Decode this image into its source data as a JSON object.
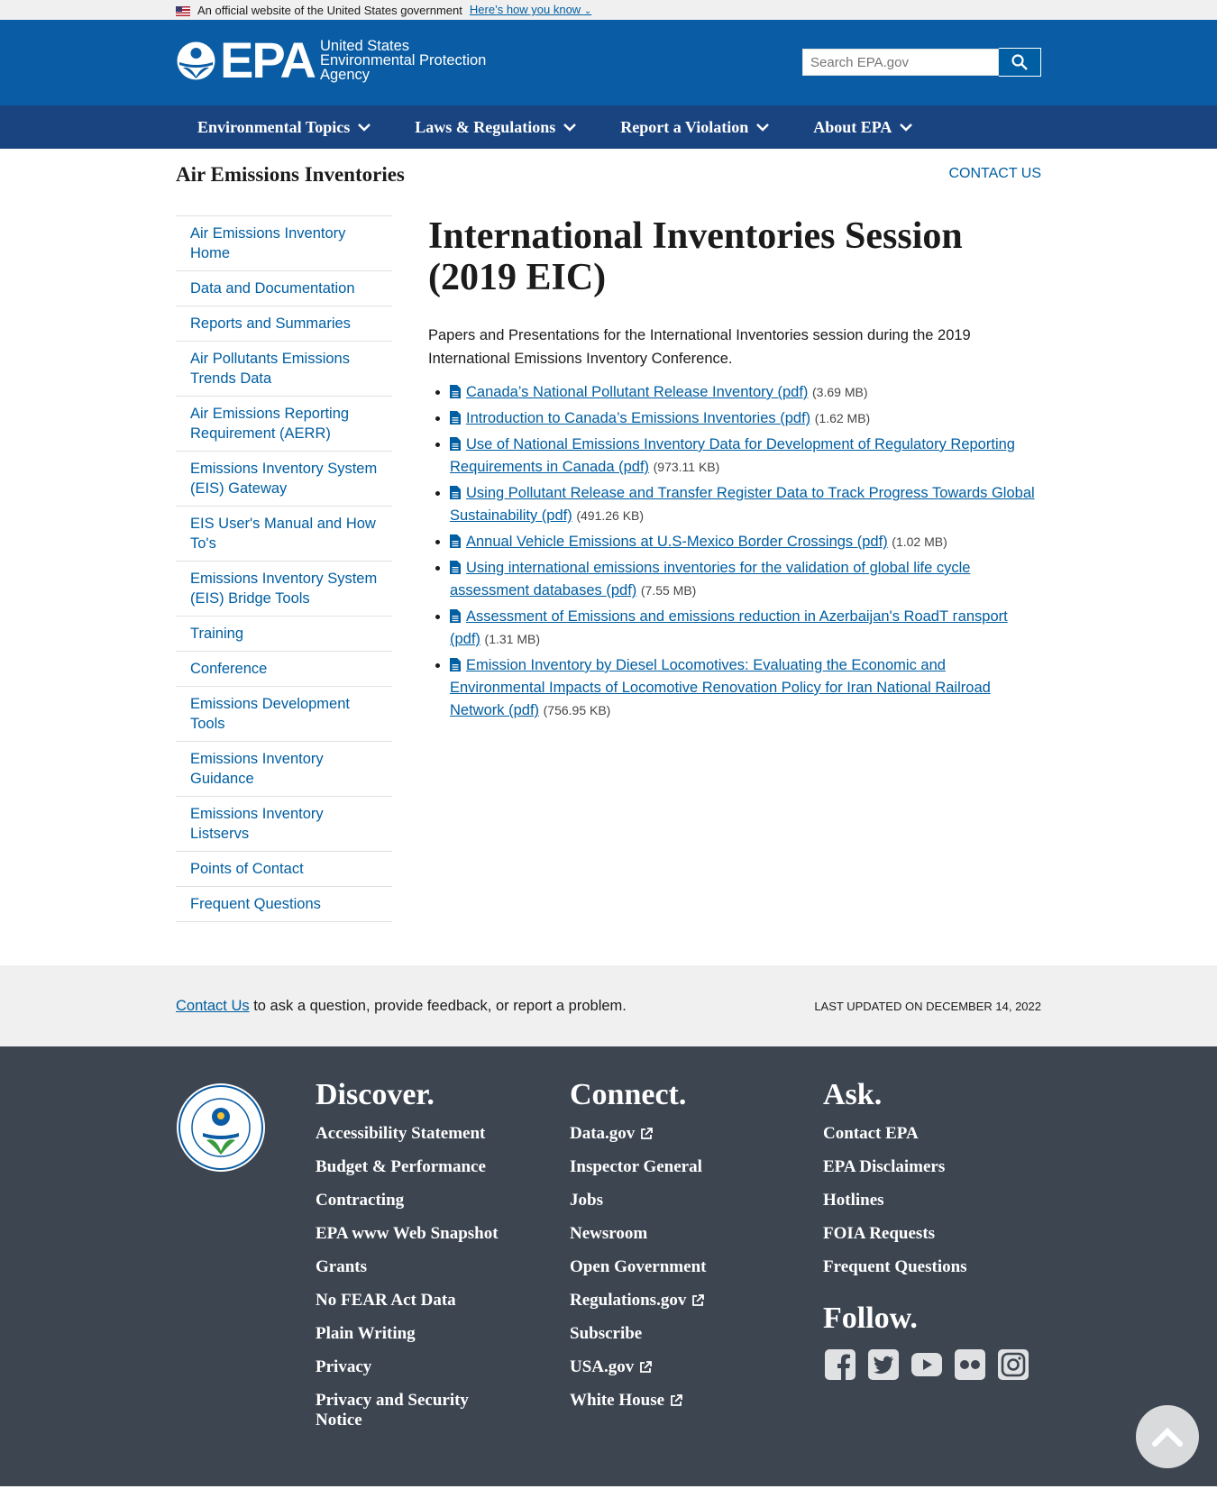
{
  "banner": {
    "official_text": "An official website of the United States government",
    "how_link": "Here’s how you know"
  },
  "header": {
    "logo_epa": "EPA",
    "logo_line1": "United States",
    "logo_line2": "Environmental Protection",
    "logo_line3": "Agency",
    "search_placeholder": "Search EPA.gov"
  },
  "nav": {
    "items": [
      {
        "label": "Environmental Topics"
      },
      {
        "label": "Laws & Regulations"
      },
      {
        "label": "Report a Violation"
      },
      {
        "label": "About EPA"
      }
    ]
  },
  "page": {
    "microsite_title": "Air Emissions Inventories",
    "contact_us": "Contact Us"
  },
  "sidebar": {
    "items": [
      {
        "label": "Air Emissions Inventory Home"
      },
      {
        "label": "Data and Documentation"
      },
      {
        "label": "Reports and Summaries"
      },
      {
        "label": "Air Pollutants Emissions Trends Data"
      },
      {
        "label": "Air Emissions Reporting Requirement (AERR)"
      },
      {
        "label": "Emissions Inventory System (EIS) Gateway"
      },
      {
        "label": "EIS User's Manual and How To's"
      },
      {
        "label": "Emissions Inventory System (EIS) Bridge Tools"
      },
      {
        "label": "Training"
      },
      {
        "label": "Conference"
      },
      {
        "label": "Emissions Development Tools"
      },
      {
        "label": "Emissions Inventory Guidance"
      },
      {
        "label": "Emissions Inventory Listservs"
      },
      {
        "label": "Points of Contact"
      },
      {
        "label": "Frequent Questions"
      }
    ]
  },
  "main": {
    "title": "International Inventories Session (2019 EIC)",
    "intro": "Papers and Presentations for the International Inventories session during the 2019 International Emissions Inventory Conference.",
    "files": [
      {
        "title": "Canada’s National Pollutant Release Inventory (pdf)",
        "size": "(3.69 MB)"
      },
      {
        "title": "Introduction to Canada’s Emissions Inventories (pdf)",
        "size": "(1.62 MB)"
      },
      {
        "title": "Use of National Emissions Inventory Data for Development of Regulatory Reporting Requirements in Canada (pdf)",
        "size": "(973.11 KB)"
      },
      {
        "title": "Using Pollutant Release and Transfer Register Data to Track Progress Towards Global Sustainability (pdf)",
        "size": "(491.26 KB)"
      },
      {
        "title": "Annual Vehicle Emissions at U.S-Mexico Border Crossings (pdf)",
        "size": "(1.02 MB)"
      },
      {
        "title": "Using international emissions inventories for the validation of global life cycle assessment databases (pdf)",
        "size": "(7.55 MB)"
      },
      {
        "title": "Assessment of Emissions and emissions reduction in Azerbaijan's RoadТ гansport (pdf)",
        "size": "(1.31 MB)"
      },
      {
        "title": "Emission Inventory by Diesel Locomotives: Evaluating the Economic and Environmental Impacts of Locomotive Renovation Policy for Iran National Railroad Network (pdf)",
        "size": "(756.95 KB)"
      }
    ]
  },
  "last_updated": {
    "contact_link": "Contact Us",
    "contact_rest": " to ask a question, provide feedback, or report a problem.",
    "date": "Last updated on December 14, 2022"
  },
  "footer": {
    "discover": {
      "heading": "Discover.",
      "links": [
        "Accessibility Statement",
        "Budget & Performance",
        "Contracting",
        "EPA www Web Snapshot",
        "Grants",
        "No FEAR Act Data",
        "Plain Writing",
        "Privacy",
        "Privacy and Security Notice"
      ]
    },
    "connect": {
      "heading": "Connect.",
      "links": [
        "Data.gov",
        "Inspector General",
        "Jobs",
        "Newsroom",
        "Open Government",
        "Regulations.gov",
        "Subscribe",
        "USA.gov",
        "White House"
      ]
    },
    "ask": {
      "heading": "Ask.",
      "links": [
        "Contact EPA",
        "EPA Disclaimers",
        "Hotlines",
        "FOIA Requests",
        "Frequent Questions"
      ]
    },
    "follow": {
      "heading": "Follow."
    }
  },
  "icons": {
    "social": [
      "facebook-icon",
      "twitter-icon",
      "youtube-icon",
      "flickr-icon",
      "instagram-icon"
    ]
  },
  "colors": {
    "header_blue": "#0a5da4",
    "nav_blue": "#1a4480",
    "link_blue": "#005ea2",
    "footer_bg": "#3d4551"
  }
}
